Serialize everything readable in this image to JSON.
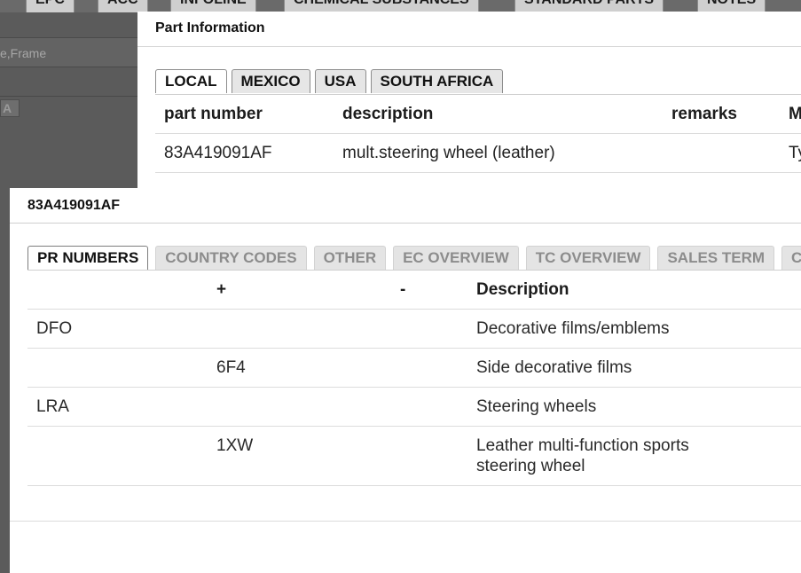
{
  "background_app": {
    "tabs": [
      "EPC",
      "ACC",
      "INFOLINE",
      "CHEMICAL SUBSTANCES",
      "STANDARD PARTS",
      "NOTES"
    ],
    "search_placeholder": "e,Frame",
    "a_button": "A"
  },
  "part_info_dialog": {
    "title": "Part Information",
    "tabs": [
      "LOCAL",
      "MEXICO",
      "USA",
      "SOUTH AFRICA"
    ],
    "active_tab": "LOCAL",
    "columns": [
      "part number",
      "description",
      "remarks",
      "M"
    ],
    "rows": [
      {
        "part_number": "83A419091AF",
        "description": "mult.steering wheel (leather)",
        "remarks": "",
        "m": "Ty"
      }
    ]
  },
  "part_detail_dialog": {
    "title": "83A419091AF",
    "tabs": [
      "PR NUMBERS",
      "COUNTRY CODES",
      "OTHER",
      "EC OVERVIEW",
      "TC OVERVIEW",
      "SALES TERM",
      "C"
    ],
    "active_tab": "PR NUMBERS",
    "columns": [
      "",
      "+",
      "-",
      "Description"
    ],
    "rows": [
      {
        "family": "DFO",
        "plus": "",
        "minus": "",
        "description": "Decorative films/emblems"
      },
      {
        "family": "",
        "plus": "6F4",
        "minus": "",
        "description": "Side decorative films"
      },
      {
        "family": "LRA",
        "plus": "",
        "minus": "",
        "description": "Steering wheels"
      },
      {
        "family": "",
        "plus": "1XW",
        "minus": "",
        "description": "Leather multi-function sports steering wheel"
      }
    ]
  }
}
